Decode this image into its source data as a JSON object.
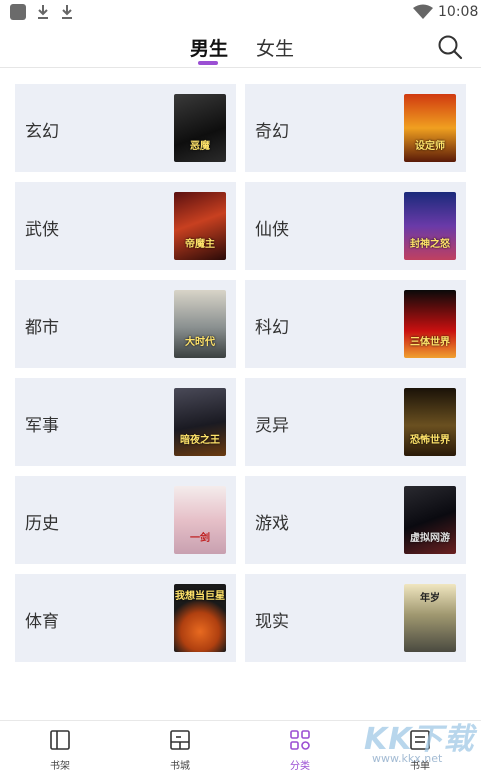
{
  "status_bar": {
    "time": "10:08"
  },
  "header": {
    "tabs": [
      {
        "label": "男生",
        "active": true
      },
      {
        "label": "女生",
        "active": false
      }
    ],
    "accent_color": "#9b4fd3"
  },
  "categories": [
    {
      "label": "玄幻",
      "cover_text": "恶魔"
    },
    {
      "label": "奇幻",
      "cover_text": "设定师"
    },
    {
      "label": "武侠",
      "cover_text": "帝魔主"
    },
    {
      "label": "仙侠",
      "cover_text": "封神之怒"
    },
    {
      "label": "都市",
      "cover_text": "大时代"
    },
    {
      "label": "科幻",
      "cover_text": "三体世界"
    },
    {
      "label": "军事",
      "cover_text": "暗夜之王"
    },
    {
      "label": "灵异",
      "cover_text": "恐怖世界"
    },
    {
      "label": "历史",
      "cover_text": "一剑"
    },
    {
      "label": "游戏",
      "cover_text": "虚拟网游"
    },
    {
      "label": "体育",
      "cover_text": "我想当巨星"
    },
    {
      "label": "现实",
      "cover_text": "年岁"
    }
  ],
  "bottom_nav": [
    {
      "label": "书架",
      "icon": "bookshelf-icon",
      "active": false
    },
    {
      "label": "书城",
      "icon": "bookstore-icon",
      "active": false
    },
    {
      "label": "分类",
      "icon": "category-icon",
      "active": true
    },
    {
      "label": "书单",
      "icon": "booklist-icon",
      "active": false
    }
  ],
  "watermark": {
    "big": "KK下载",
    "url": "www.kkx.net"
  }
}
